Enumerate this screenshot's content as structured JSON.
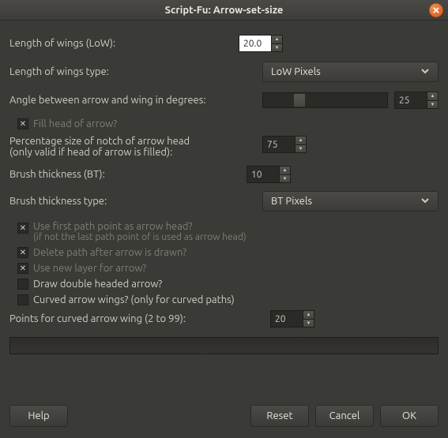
{
  "window": {
    "title": "Script-Fu: Arrow-set-size"
  },
  "fields": {
    "low_label": "Length of wings (LoW):",
    "low_value": "20.0",
    "low_type_label": "Length of wings type:",
    "low_type_value": "LoW Pixels",
    "angle_label": "Angle between arrow and wing in degrees:",
    "angle_value": "25",
    "angle_slider_pos_pct": 24,
    "fill_head_label": "Fill head of arrow?",
    "fill_head_checked": true,
    "notch_label_1": "Percentage size of notch of arrow head",
    "notch_label_2": "(only valid if head of arrow is filled):",
    "notch_value": "75",
    "bt_label": "Brush thickness (BT):",
    "bt_value": "10",
    "bt_type_label": "Brush thickness type:",
    "bt_type_value": "BT Pixels",
    "first_point_label_1": "Use first path point as arrow head?",
    "first_point_label_2": "(if not the last path point of is used as arrow head)",
    "first_point_checked": true,
    "delete_path_label": "Delete path after arrow is drawn?",
    "delete_path_checked": true,
    "new_layer_label": "Use new layer for arrow?",
    "new_layer_checked": true,
    "double_head_label": "Draw double headed arrow?",
    "double_head_checked": false,
    "curved_label": "Curved arrow wings? (only for curved paths)",
    "curved_checked": false,
    "points_label": "Points for curved arrow wing (2 to 99):",
    "points_value": "20"
  },
  "buttons": {
    "help": "Help",
    "reset": "Reset",
    "cancel": "Cancel",
    "ok": "OK"
  }
}
